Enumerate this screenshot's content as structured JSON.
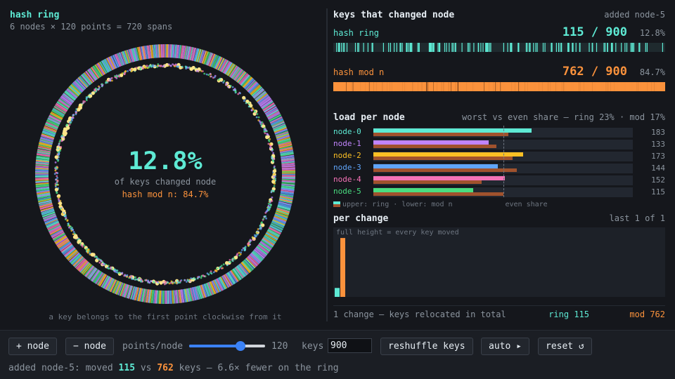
{
  "ring_panel": {
    "title": "hash ring",
    "subtitle": "6 nodes × 120 points = 720 spans",
    "center_pct": "12.8%",
    "center_label": "of keys changed node",
    "center_mod": "hash mod n: 84.7%",
    "footer": "a key belongs to the first point clockwise from it"
  },
  "changed": {
    "title": "keys that changed node",
    "event": "added node-5",
    "ring": {
      "name": "hash ring",
      "count": "115 / 900",
      "pct": "12.8%",
      "moved_fraction": 0.128
    },
    "mod": {
      "name": "hash mod n",
      "count": "762 / 900",
      "pct": "84.7%",
      "moved_fraction": 0.847
    }
  },
  "load": {
    "title": "load per node",
    "note": "worst vs even share — ring 23% · mod 17%",
    "even_share": 150,
    "scale_max": 300,
    "nodes": [
      {
        "name": "node-0",
        "color": "#5eead4",
        "ring": 183,
        "mod": 156
      },
      {
        "name": "node-1",
        "color": "#c084fc",
        "ring": 133,
        "mod": 142
      },
      {
        "name": "node-2",
        "color": "#fbbf24",
        "ring": 173,
        "mod": 161
      },
      {
        "name": "node-3",
        "color": "#60a5fa",
        "ring": 144,
        "mod": 166
      },
      {
        "name": "node-4",
        "color": "#f472b6",
        "ring": 152,
        "mod": 125
      },
      {
        "name": "node-5",
        "color": "#4ade80",
        "ring": 115,
        "mod": 150
      }
    ],
    "legend": "upper: ring · lower: mod n",
    "even_label": "even share"
  },
  "per_change": {
    "title": "per change",
    "note": "last 1 of 1",
    "hint": "full height = every key moved",
    "changes": [
      {
        "ring": 0.128,
        "mod": 0.847
      }
    ],
    "total_text": "1 change — keys relocated in total",
    "total_ring": "ring 115",
    "total_mod": "mod 762"
  },
  "controls": {
    "add_node": "+ node",
    "remove_node": "− node",
    "points_label": "points/node",
    "points_value": "120",
    "points_fraction": 0.7,
    "keys_label": "keys",
    "keys_value": "900",
    "reshuffle": "reshuffle keys",
    "auto": "auto ▸",
    "reset": "reset ↺"
  },
  "status": {
    "prefix": "added node-5: moved ",
    "ring_count": "115",
    "vs": " vs ",
    "mod_count": "762",
    "suffix": " keys — 6.6× fewer on the ring"
  },
  "colors": {
    "ring": "#5eead4",
    "mod": "#fb923c",
    "mod_dark": "#a0522d"
  }
}
